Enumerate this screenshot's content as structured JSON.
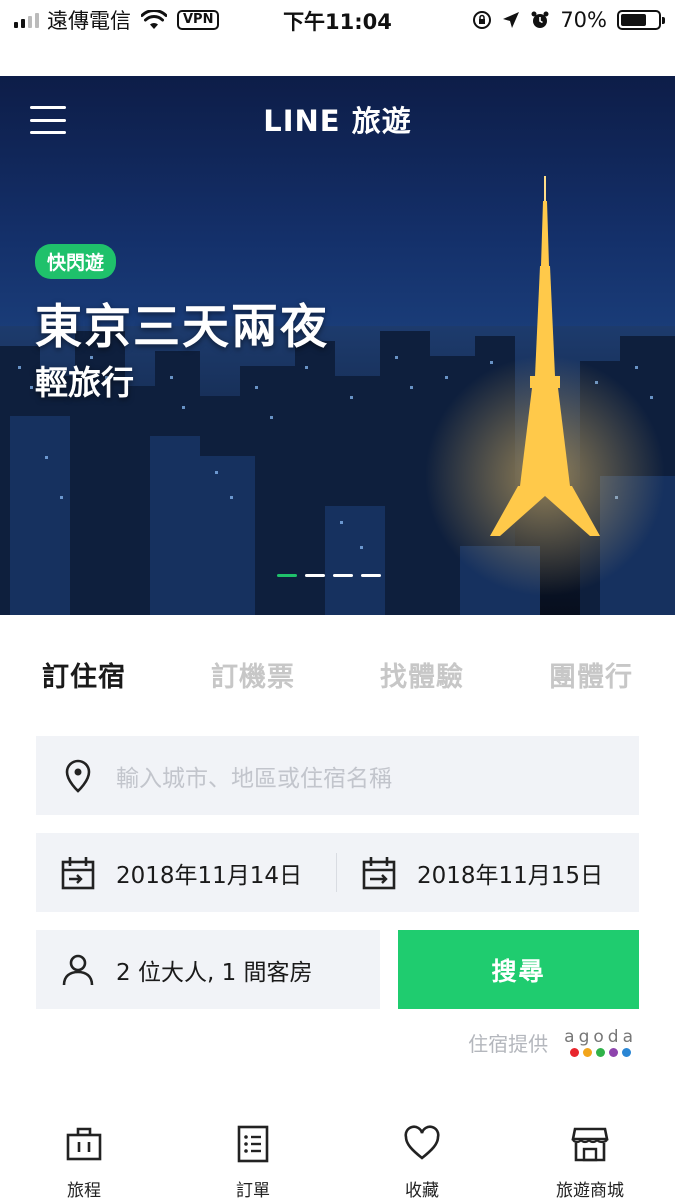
{
  "status_bar": {
    "carrier": "遠傳電信",
    "vpn": "VPN",
    "time": "下午11:04",
    "battery": "70%",
    "battery_level": 0.7
  },
  "header": {
    "brand": "LINE 旅遊"
  },
  "hero": {
    "tag": "快閃遊",
    "title": "東京三天兩夜",
    "subtitle": "輕旅行",
    "slides_count": 4,
    "active_slide": 1
  },
  "tabs": [
    {
      "label": "訂住宿",
      "active": true
    },
    {
      "label": "訂機票",
      "active": false
    },
    {
      "label": "找體驗",
      "active": false
    },
    {
      "label": "團體行",
      "active": false
    }
  ],
  "search": {
    "placeholder": "輸入城市、地區或住宿名稱"
  },
  "dates": {
    "checkin": "2018年11月14日",
    "checkout": "2018年11月15日"
  },
  "guests": {
    "value": "2 位大人, 1 間客房"
  },
  "search_button": {
    "label": "搜尋"
  },
  "provider": {
    "label": "住宿提供",
    "logo_text": "agoda",
    "logo_colors": [
      "#e8262d",
      "#f2a51b",
      "#31b34a",
      "#8e44ad",
      "#2a86d4"
    ]
  },
  "bottom_nav": [
    {
      "label": "旅程",
      "icon": "briefcase-icon"
    },
    {
      "label": "訂單",
      "icon": "list-icon"
    },
    {
      "label": "收藏",
      "icon": "heart-icon"
    },
    {
      "label": "旅遊商城",
      "icon": "shop-icon"
    }
  ],
  "colors": {
    "accent": "#1fcc6f",
    "field_bg": "#f1f3f7",
    "inactive_tab": "#c7c7c7"
  }
}
